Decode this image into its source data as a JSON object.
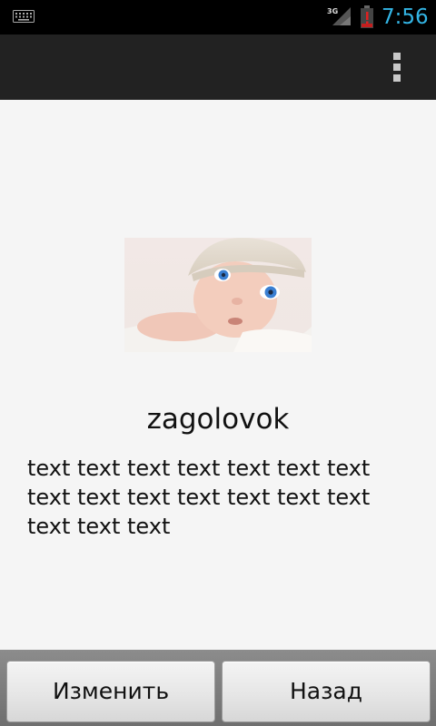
{
  "status_bar": {
    "time": "7:56",
    "network_label": "3G",
    "icons": [
      "keyboard-icon",
      "signal-icon",
      "battery-icon"
    ]
  },
  "action_bar": {
    "overflow_icon": "overflow-menu-icon"
  },
  "content": {
    "image": "baby-photo",
    "heading": "zagolovok",
    "body": "text text text text text text text text text text text text text text text text text"
  },
  "buttons": {
    "edit": "Изменить",
    "back": "Назад"
  },
  "colors": {
    "accent": "#33b5e5",
    "action_bar": "#222222",
    "background": "#f5f5f5"
  }
}
